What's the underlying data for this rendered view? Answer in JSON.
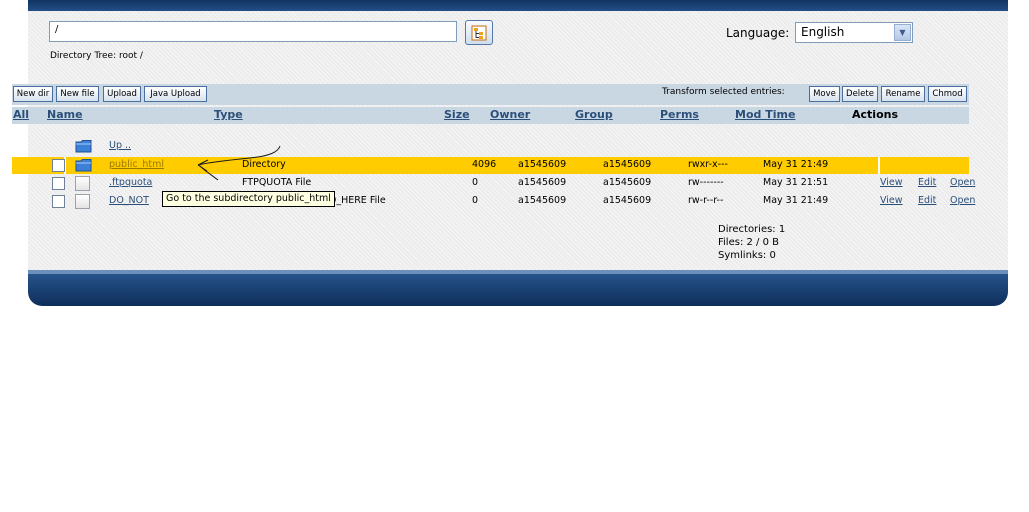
{
  "path_bar": {
    "value": "/",
    "directory_tree_label": "Directory Tree: root /"
  },
  "language": {
    "label": "Language:",
    "selected": "English"
  },
  "toolbar": {
    "new_dir": "New dir",
    "new_file": "New file",
    "upload": "Upload",
    "java_upload": "Java Upload",
    "transform_label": "Transform selected entries:",
    "move": "Move",
    "delete": "Delete",
    "rename": "Rename",
    "chmod": "Chmod"
  },
  "table": {
    "headers": {
      "all": "All",
      "name": "Name",
      "type": "Type",
      "size": "Size",
      "owner": "Owner",
      "group": "Group",
      "perms": "Perms",
      "mod_time": "Mod Time",
      "actions": "Actions"
    },
    "up_label": "Up ..",
    "rows": [
      {
        "name": "public_html",
        "type": "Directory",
        "size": "4096",
        "owner": "a1545609",
        "group": "a1545609",
        "perms": "rwxr-x---",
        "mod_time": "May 31 21:49",
        "icon": "folder-icon"
      },
      {
        "name": ".ftpquota",
        "type": "FTPQUOTA File",
        "size": "0",
        "owner": "a1545609",
        "group": "a1545609",
        "perms": "rw-------",
        "mod_time": "May 31 21:51",
        "icon": "file-icon",
        "actions": [
          "View",
          "Edit",
          "Open"
        ]
      },
      {
        "name": "DO_NOT",
        "type": "D_HERE File",
        "size": "0",
        "owner": "a1545609",
        "group": "a1545609",
        "perms": "rw-r--r--",
        "mod_time": "May 31 21:49",
        "icon": "file-icon",
        "actions": [
          "View",
          "Edit",
          "Open"
        ]
      }
    ]
  },
  "tooltip": "Go to the subdirectory public_html",
  "stats": {
    "directories": "Directories: 1",
    "files": "Files: 2 / 0 B",
    "symlinks": "Symlinks: 0"
  },
  "colors": {
    "banner_dark": "#0f3460",
    "toolbar_bg": "#c9d7e3",
    "selected_row": "#ffcc00",
    "link": "#2b4f79"
  }
}
